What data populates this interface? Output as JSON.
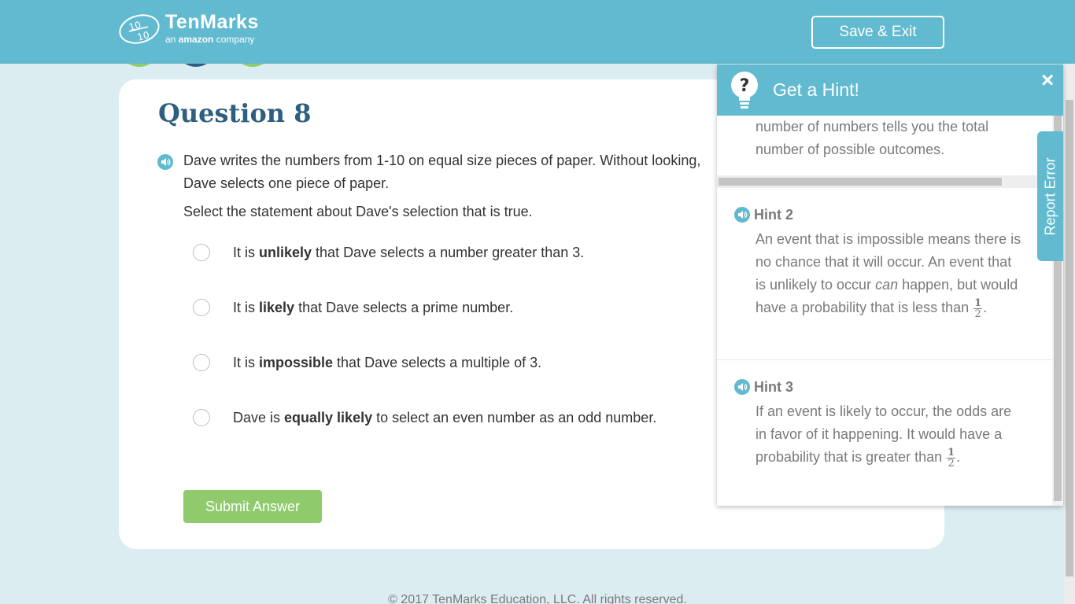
{
  "header": {
    "logo_name": "TenMarks",
    "logo_tag_prefix": "an ",
    "logo_tag_brand": "amazon",
    "logo_tag_suffix": " company",
    "save_exit_label": "Save & Exit"
  },
  "colors": {
    "header_bg": "#61bacf",
    "page_bg": "#dcedf1",
    "title_color": "#2f5f7e",
    "submit_bg": "#8fcb6c",
    "progress_dot_green": "#8fcb6c",
    "progress_dot_blue": "#2f5f7e"
  },
  "question": {
    "title": "Question 8",
    "text": "Dave writes the numbers from 1-10 on equal size pieces of paper. Without looking, Dave selects one piece of paper.",
    "prompt": "Select the statement about Dave's selection that is true.",
    "options": [
      {
        "pre": "It is ",
        "bold": "unlikely",
        "post": " that Dave selects a number greater than 3."
      },
      {
        "pre": "It is ",
        "bold": "likely",
        "post": " that Dave selects a prime number."
      },
      {
        "pre": "It is ",
        "bold": "impossible",
        "post": " that Dave selects a multiple of 3."
      },
      {
        "pre": "Dave is ",
        "bold": "equally likely",
        "post": " to select an even number as an odd number."
      }
    ],
    "submit_label": "Submit Answer"
  },
  "hint_panel": {
    "title": "Get a Hint!",
    "close_icon": "×",
    "previous_hint_tail": "number of numbers tells you the total number of possible outcomes.",
    "hints": [
      {
        "label": "Hint 2",
        "text_a": "An event that is impossible means there is no chance that it will occur. An event that is unlikely to occur ",
        "text_italic": "can",
        "text_b": " happen, but would have a probability that is less than ",
        "frac_num": "1",
        "frac_den": "2",
        "text_end": "."
      },
      {
        "label": "Hint 3",
        "text_a": "If an event is likely to occur, the odds are in favor of it happening. It would have a probability that is greater than ",
        "frac_num": "1",
        "frac_den": "2",
        "text_end": "."
      }
    ]
  },
  "report_error_label": "Report Error",
  "footer": "© 2017 TenMarks Education, LLC. All rights reserved."
}
